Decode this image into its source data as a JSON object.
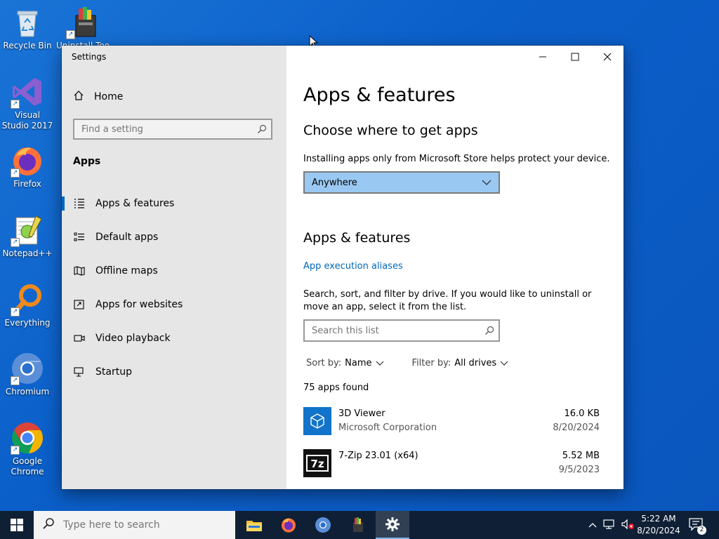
{
  "desktop": {
    "icons": [
      {
        "label": "Recycle Bin"
      },
      {
        "label": "Uninstall Tool"
      },
      {
        "label": "Visual Studio 2017"
      },
      {
        "label": "Firefox"
      },
      {
        "label": "Notepad++"
      },
      {
        "label": "Everything"
      },
      {
        "label": "Chromium"
      },
      {
        "label": "Google Chrome"
      }
    ]
  },
  "window": {
    "title": "Settings",
    "controls": {
      "minimize": "—",
      "maximize": "☐",
      "close": "✕"
    }
  },
  "nav": {
    "home_label": "Home",
    "search_placeholder": "Find a setting",
    "section_label": "Apps",
    "items": [
      {
        "label": "Apps & features",
        "icon": "list-icon",
        "selected": true
      },
      {
        "label": "Default apps",
        "icon": "default-apps-icon",
        "selected": false
      },
      {
        "label": "Offline maps",
        "icon": "map-icon",
        "selected": false
      },
      {
        "label": "Apps for websites",
        "icon": "website-link-icon",
        "selected": false
      },
      {
        "label": "Video playback",
        "icon": "video-icon",
        "selected": false
      },
      {
        "label": "Startup",
        "icon": "startup-icon",
        "selected": false
      }
    ]
  },
  "content": {
    "page_title": "Apps & features",
    "choose_heading": "Choose where to get apps",
    "choose_desc": "Installing apps only from Microsoft Store helps protect your device.",
    "source_dropdown_value": "Anywhere",
    "section_heading": "Apps & features",
    "aliases_link": "App execution aliases",
    "list_desc": "Search, sort, and filter by drive. If you would like to uninstall or move an app, select it from the list.",
    "list_search_placeholder": "Search this list",
    "sort_label": "Sort by:",
    "sort_value": "Name",
    "filter_label": "Filter by:",
    "filter_value": "All drives",
    "apps_count": "75 apps found",
    "apps": [
      {
        "name": "3D Viewer",
        "publisher": "Microsoft Corporation",
        "size": "16.0 KB",
        "date": "8/20/2024",
        "icon": "3d-viewer-icon"
      },
      {
        "name": "7-Zip 23.01 (x64)",
        "publisher": "",
        "size": "5.52 MB",
        "date": "9/5/2023",
        "icon": "7zip-icon"
      }
    ]
  },
  "taskbar": {
    "search_placeholder": "Type here to search",
    "clock_time": "5:22 AM",
    "clock_date": "8/20/2024",
    "notification_count": "2"
  },
  "colors": {
    "accent": "#0067c0",
    "dropdown_bg": "#99c9f2",
    "link": "#0067b8",
    "nav_bg": "#e6e6e6"
  }
}
